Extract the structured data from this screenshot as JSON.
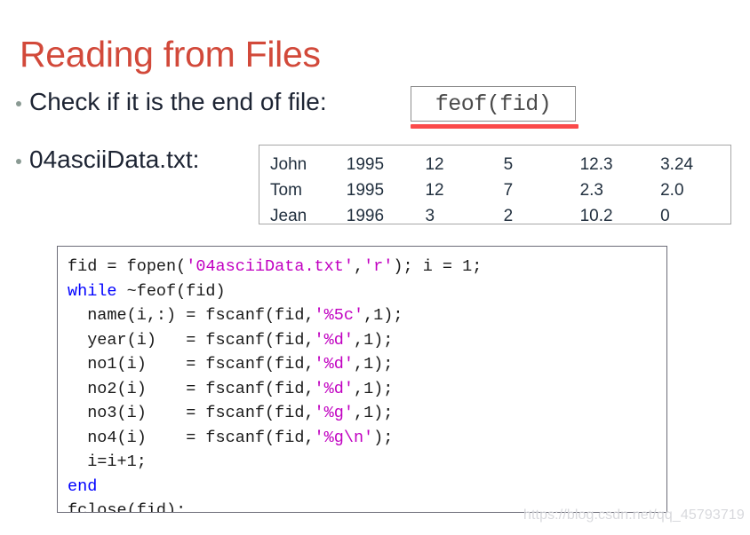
{
  "slide": {
    "title": "Reading from Files",
    "watermark": "https://blog.csdn.net/qq_45793719"
  },
  "colors": {
    "title": "#d2493a",
    "bullet_dot": "#8a9a93",
    "underline": "#fb4a4a",
    "code_keyword": "#0000ff",
    "code_string": "#c100c1",
    "code_text": "#1a1a1a",
    "box_border": "#8e8e8e"
  },
  "bullets": [
    {
      "text": "Check if it is the end of file:"
    },
    {
      "text": "04asciiData.txt:"
    }
  ],
  "inline_code": {
    "feof": "feof(fid)"
  },
  "data_file": {
    "rows": [
      [
        "John",
        "1995",
        "12",
        "5",
        "12.3",
        "3.24"
      ],
      [
        "Tom",
        "1995",
        "12",
        "7",
        "2.3",
        "2.0"
      ],
      [
        "Jean",
        "1996",
        "3",
        "2",
        "10.2",
        "0"
      ]
    ]
  },
  "code": {
    "language": "matlab",
    "lines": [
      [
        {
          "t": "fid = fopen(",
          "c": "plain"
        },
        {
          "t": "'04asciiData.txt'",
          "c": "str"
        },
        {
          "t": ",",
          "c": "plain"
        },
        {
          "t": "'r'",
          "c": "str"
        },
        {
          "t": "); i = 1;",
          "c": "plain"
        }
      ],
      [
        {
          "t": "while",
          "c": "kw"
        },
        {
          "t": " ~feof(fid)",
          "c": "plain"
        }
      ],
      [
        {
          "t": "  name(i,:) = fscanf(fid,",
          "c": "plain"
        },
        {
          "t": "'%5c'",
          "c": "str"
        },
        {
          "t": ",1);",
          "c": "plain"
        }
      ],
      [
        {
          "t": "  year(i)   = fscanf(fid,",
          "c": "plain"
        },
        {
          "t": "'%d'",
          "c": "str"
        },
        {
          "t": ",1);",
          "c": "plain"
        }
      ],
      [
        {
          "t": "  no1(i)    = fscanf(fid,",
          "c": "plain"
        },
        {
          "t": "'%d'",
          "c": "str"
        },
        {
          "t": ",1);",
          "c": "plain"
        }
      ],
      [
        {
          "t": "  no2(i)    = fscanf(fid,",
          "c": "plain"
        },
        {
          "t": "'%d'",
          "c": "str"
        },
        {
          "t": ",1);",
          "c": "plain"
        }
      ],
      [
        {
          "t": "  no3(i)    = fscanf(fid,",
          "c": "plain"
        },
        {
          "t": "'%g'",
          "c": "str"
        },
        {
          "t": ",1);",
          "c": "plain"
        }
      ],
      [
        {
          "t": "  no4(i)    = fscanf(fid,",
          "c": "plain"
        },
        {
          "t": "'%g\\n'",
          "c": "str"
        },
        {
          "t": ");",
          "c": "plain"
        }
      ],
      [
        {
          "t": "  i=i+1;",
          "c": "plain"
        }
      ],
      [
        {
          "t": "end",
          "c": "kw"
        }
      ],
      [
        {
          "t": "fclose(fid);",
          "c": "plain"
        }
      ]
    ]
  }
}
